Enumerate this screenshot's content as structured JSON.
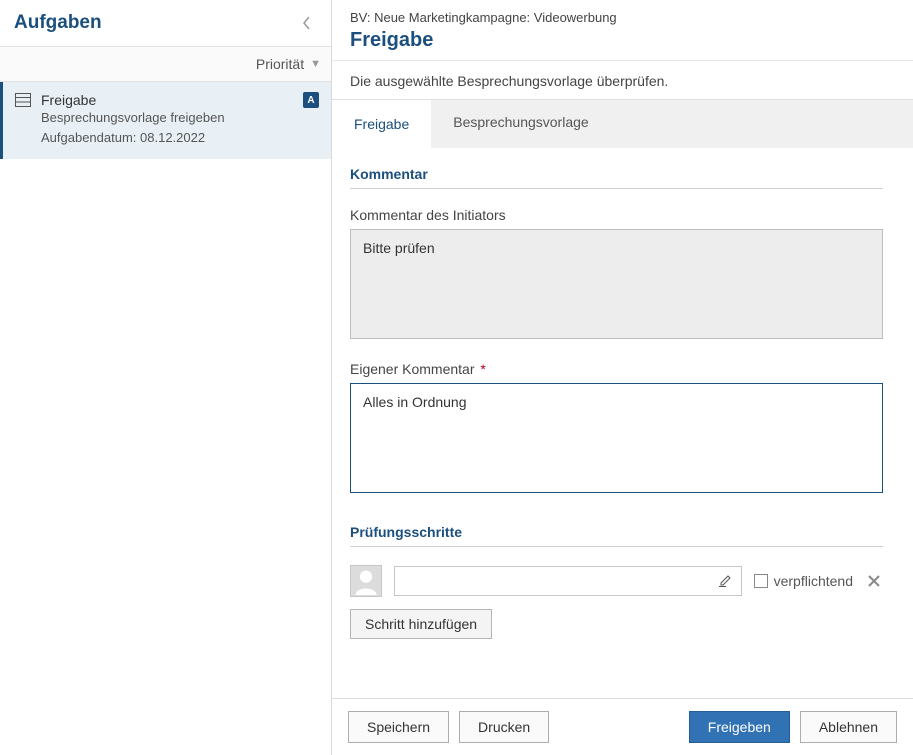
{
  "sidebar": {
    "title": "Aufgaben",
    "sort_label": "Priorität",
    "task": {
      "title": "Freigabe",
      "badge": "A",
      "line1": "Besprechungsvorlage freigeben",
      "line2": "Aufgabendatum: 08.12.2022"
    }
  },
  "main": {
    "breadcrumb": "BV: Neue Marketingkampagne: Videowerbung",
    "title": "Freigabe",
    "description": "Die ausgewählte Besprechungsvorlage überprüfen."
  },
  "tabs": {
    "t1": "Freigabe",
    "t2": "Besprechungsvorlage"
  },
  "comment_section": {
    "header": "Kommentar",
    "initiator_label": "Kommentar des Initiators",
    "initiator_value": "Bitte prüfen",
    "own_label": "Eigener Kommentar",
    "own_value": "Alles in Ordnung"
  },
  "steps_section": {
    "header": "Prüfungsschritte",
    "mandatory_label": "verpflichtend",
    "add_step": "Schritt hinzufügen"
  },
  "footer": {
    "save": "Speichern",
    "print": "Drucken",
    "approve": "Freigeben",
    "reject": "Ablehnen"
  }
}
